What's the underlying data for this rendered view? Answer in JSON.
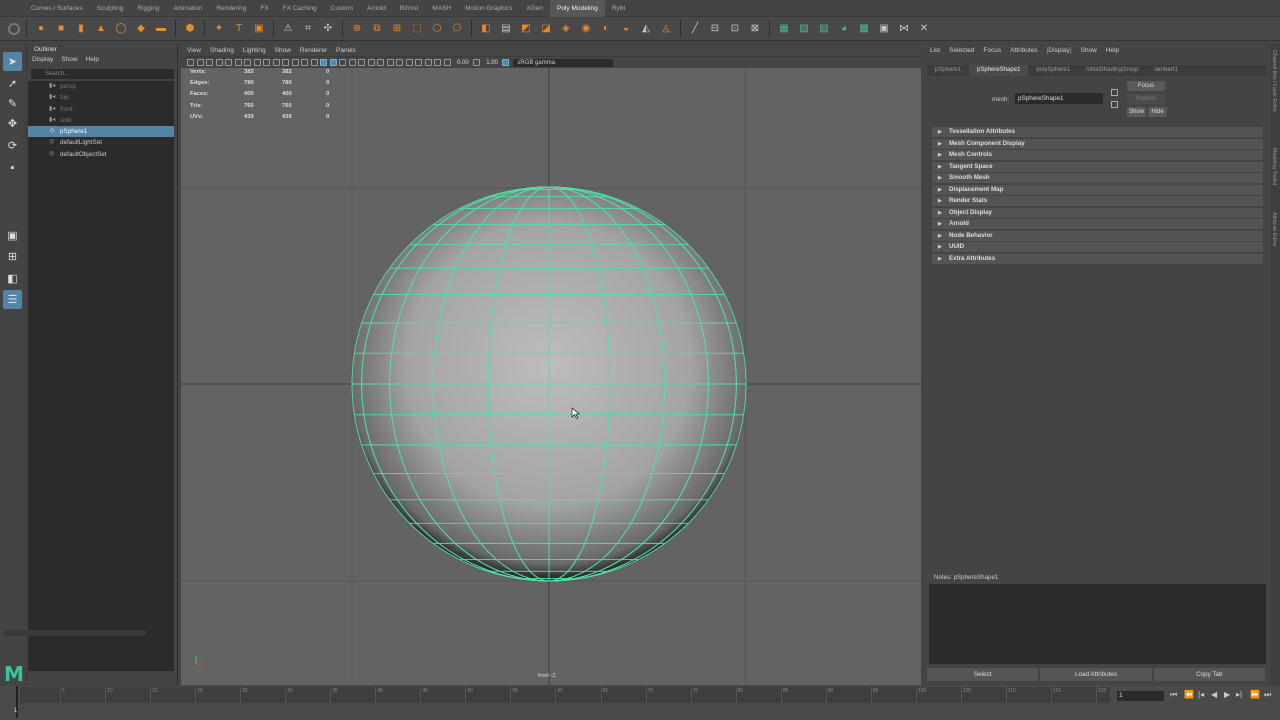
{
  "shelf": {
    "tabs": [
      "Curves / Surfaces",
      "Sculpting",
      "Rigging",
      "Animation",
      "Rendering",
      "FX",
      "FX Caching",
      "Custom",
      "Arnold",
      "Bifrost",
      "MASH",
      "Motion Graphics",
      "XGen",
      "Poly Modeling",
      "Rybt"
    ],
    "active_tab": "Poly Modeling"
  },
  "outliner": {
    "title": "Outliner",
    "menu": [
      "Display",
      "Show",
      "Help"
    ],
    "search_placeholder": "Search...",
    "items": [
      {
        "label": "persp",
        "dim": true
      },
      {
        "label": "top",
        "dim": true
      },
      {
        "label": "front",
        "dim": true
      },
      {
        "label": "side",
        "dim": true
      },
      {
        "label": "pSphere1",
        "selected": true
      },
      {
        "label": "defaultLightSet"
      },
      {
        "label": "defaultObjectSet"
      }
    ]
  },
  "viewport": {
    "menu": [
      "View",
      "Shading",
      "Lighting",
      "Show",
      "Renderer",
      "Panels"
    ],
    "exposure": "0.00",
    "gamma": "1.00",
    "color_space": "sRGB gamma",
    "camera_label": "front -Z",
    "hud": [
      {
        "label": "Verts:",
        "a": "382",
        "b": "382",
        "c": "0"
      },
      {
        "label": "Edges:",
        "a": "780",
        "b": "780",
        "c": "0"
      },
      {
        "label": "Faces:",
        "a": "400",
        "b": "400",
        "c": "0"
      },
      {
        "label": "Tris:",
        "a": "760",
        "b": "760",
        "c": "0"
      },
      {
        "label": "UVs:",
        "a": "439",
        "b": "439",
        "c": "0"
      }
    ],
    "wire_color": "#4fe0a6"
  },
  "attribute_editor": {
    "menu": [
      "List",
      "Selected",
      "Focus",
      "Attributes",
      "Display",
      "Show",
      "Help"
    ],
    "menu_highlight": "Display",
    "tabs": [
      "pSphere1",
      "pSphereShape1",
      "polySphere1",
      "initialShadingGroup",
      "lambert1"
    ],
    "active_tab": "pSphereShape1",
    "mesh_label": "mesh:",
    "mesh_value": "pSphereShape1",
    "focus_btn": "Focus",
    "presets_btn": "Presets",
    "show_btn": "Show",
    "hide_btn": "Hide",
    "sections": [
      "Tessellation Attributes",
      "Mesh Component Display",
      "Mesh Controls",
      "Tangent Space",
      "Smooth Mesh",
      "Displacement Map",
      "Render Stats",
      "Object Display",
      "Arnold",
      "Node Behavior",
      "UUID",
      "Extra Attributes"
    ],
    "notes_label": "Notes:  pSphereShape1",
    "bottom_buttons": [
      "Select",
      "Load Attributes",
      "Copy Tab"
    ],
    "side_tabs": [
      "Channel Box / Layer Editor",
      "Modeling Toolkit",
      "Attribute Editor"
    ]
  },
  "timeline": {
    "ticks": [
      "5",
      "10",
      "15",
      "20",
      "25",
      "30",
      "35",
      "40",
      "45",
      "50",
      "55",
      "60",
      "65",
      "70",
      "75",
      "80",
      "85",
      "90",
      "95",
      "100",
      "105",
      "110",
      "115",
      "120"
    ],
    "current_frame": "1",
    "frame_field": "1"
  },
  "logo": "M"
}
